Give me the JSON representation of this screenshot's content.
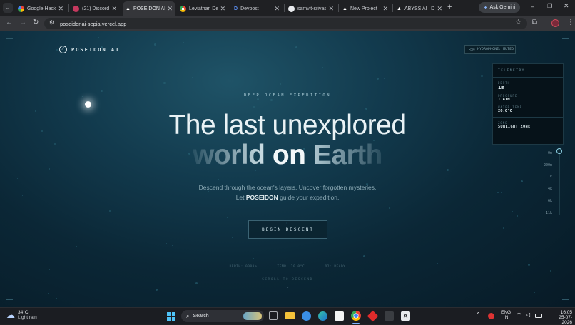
{
  "browser": {
    "tabs": [
      {
        "label": "Google Hacki",
        "color": "#e8eaed"
      },
      {
        "label": "(21) Discord |",
        "color": "#c6395f"
      },
      {
        "label": "POSEIDON AI",
        "color": "#e8eaed"
      },
      {
        "label": "Leviathan De",
        "color": "#e8eaed"
      },
      {
        "label": "Devpost",
        "color": "#3b5ad9"
      },
      {
        "label": "samvit-srivas",
        "color": "#e8eaed"
      },
      {
        "label": "New Project",
        "color": "#e8eaed"
      },
      {
        "label": "ABYSS AI | De",
        "color": "#e8eaed"
      }
    ],
    "active_tab_index": 2,
    "ask_gemini": "Ask Gemini",
    "url": "poseidonai-sepia.vercel.app"
  },
  "site": {
    "logo_text": "POSEIDON AI",
    "hydrophone": "HYDROPHONE: MUTED",
    "telemetry": {
      "title": "TELEMETRY",
      "depth_label": "DEPTH",
      "depth_value": "1m",
      "pressure_label": "PRESSURE",
      "pressure_value": "1 ATM",
      "water_temp_label": "WATER TEMP",
      "water_temp_value": "20.0°C",
      "zone_label": "ZONE",
      "zone_value": "SUNLIGHT ZONE"
    },
    "depth_scale": [
      "0m",
      "200m",
      "1k",
      "4k",
      "6k",
      "11k"
    ],
    "eyebrow": "DEEP OCEAN EXPEDITION",
    "headline_1": "The last unexplored",
    "headline_2a": "world",
    "headline_2b": "on",
    "headline_2c": "Earth",
    "sub_1": "Descend through the ocean's layers. Uncover forgotten mysteries.",
    "sub_2_pre": "Let",
    "sub_2_brand": "POSEIDON",
    "sub_2_post": "guide your expedition.",
    "cta": "BEGIN DESCENT",
    "stats": [
      "DEPTH: 0000m",
      "TEMP: 20.0°C",
      "O2: READY"
    ],
    "scroll_hint": "SCROLL TO DESCEND"
  },
  "taskbar": {
    "weather_temp": "34°C",
    "weather_desc": "Light rain",
    "search_placeholder": "Search",
    "lang_1": "ENG",
    "lang_2": "IN",
    "time": "16:05",
    "date": "25-07-2026"
  },
  "colors": {
    "accent": "#7fc3d6",
    "ocean_deep": "#071a26"
  }
}
